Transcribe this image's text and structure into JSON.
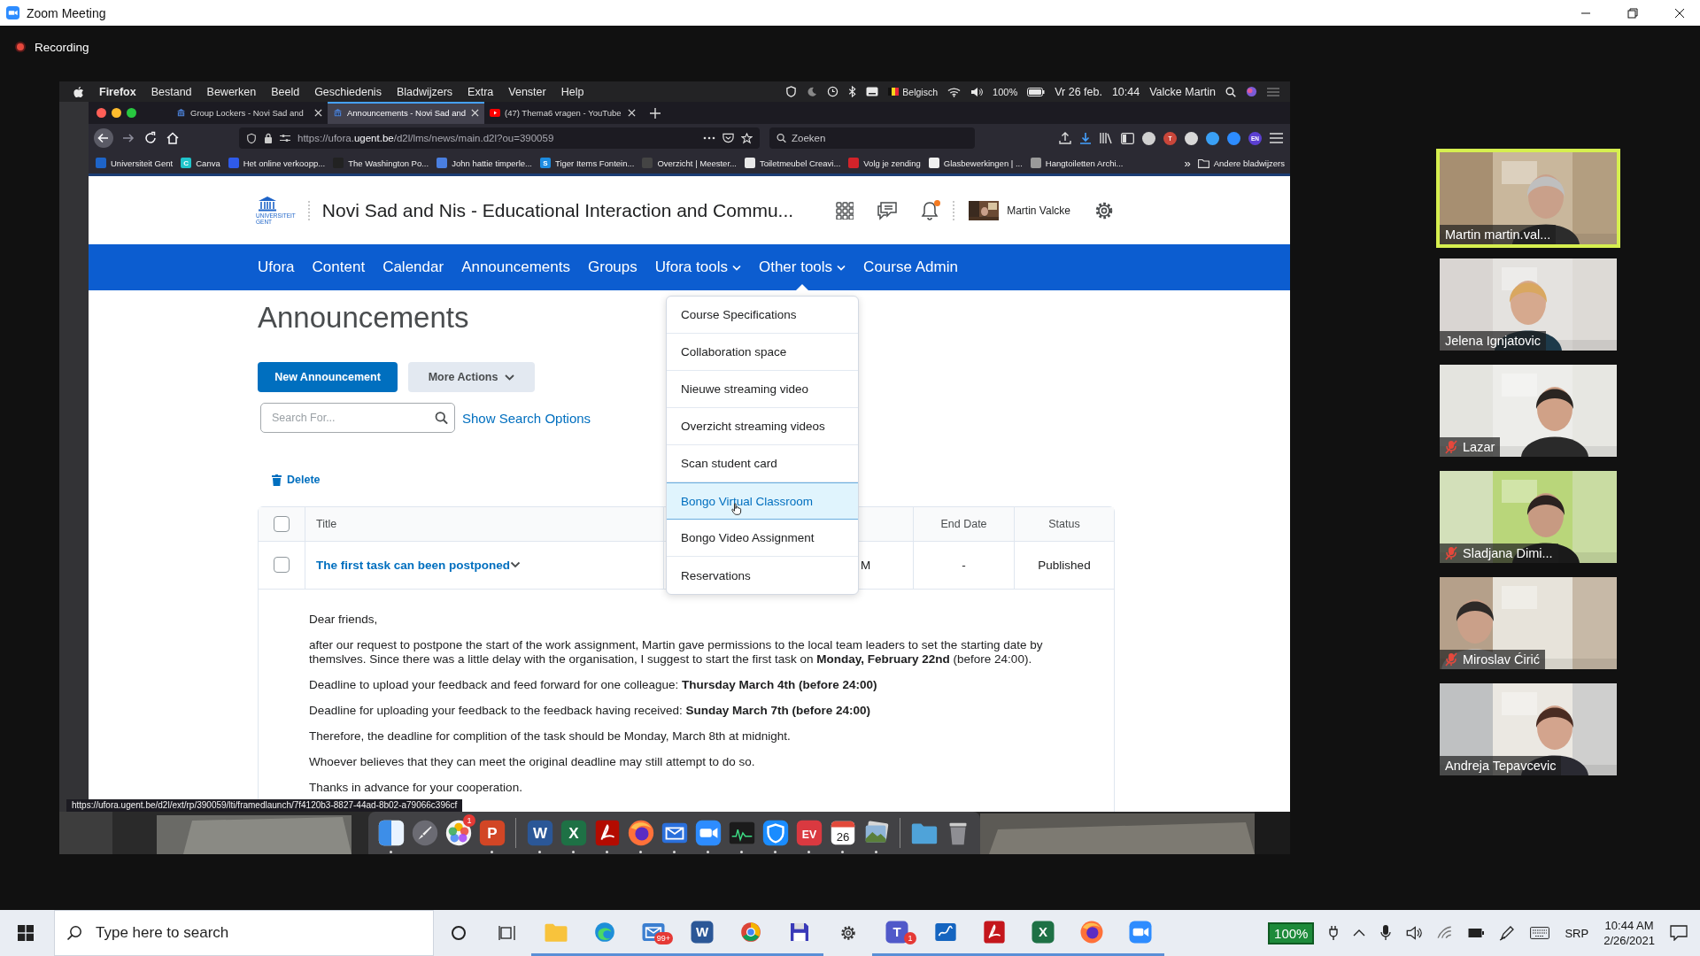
{
  "zoom_window": {
    "title": "Zoom Meeting"
  },
  "recording": {
    "label": "Recording"
  },
  "mac_menu_bar": {
    "app": "Firefox",
    "menus": [
      "Bestand",
      "Bewerken",
      "Beeld",
      "Geschiedenis",
      "Bladwijzers",
      "Extra",
      "Venster",
      "Help"
    ],
    "keyboard_layout": "Belgisch",
    "battery": "100%",
    "date": "Vr 26 feb.",
    "time": "10:44",
    "user": "Valcke Martin"
  },
  "browser": {
    "tabs": [
      {
        "title": "Group Lockers - Novi Sad and",
        "selected": false
      },
      {
        "title": "Announcements - Novi Sad and",
        "selected": true
      },
      {
        "title": "(47) Thema6 vragen - YouTube",
        "selected": false
      }
    ],
    "url": {
      "prefix": "https://ufora.",
      "host": "ugent.be",
      "path": "/d2l/lms/news/main.d2l?ou=390059"
    },
    "search": {
      "placeholder": "Zoeken"
    },
    "extensions": [
      {
        "color": "#d0d0d0"
      },
      {
        "color": "#c9463a",
        "label": "T"
      },
      {
        "color": "#d8d8d8"
      },
      {
        "color": "#3aa0f5"
      },
      {
        "color": "#2d8cff"
      },
      {
        "color": "#5b3fd1",
        "label": "EN"
      }
    ],
    "bookmarks": [
      {
        "label": "Universiteit Gent",
        "color": "#1e64c8"
      },
      {
        "label": "Canva",
        "color": "#20c4cb",
        "glyph": "C"
      },
      {
        "label": "Het online verkoopp...",
        "color": "#2f5bea"
      },
      {
        "label": "The Washington Po...",
        "color": "#222222"
      },
      {
        "label": "John hattie timperle...",
        "color": "#4a7fe0"
      },
      {
        "label": "Tiger Items Fontein...",
        "color": "#1d8ce0",
        "glyph": "S"
      },
      {
        "label": "Overzicht | Meester...",
        "color": "#444444"
      },
      {
        "label": "Toiletmeubel Creavi...",
        "color": "#e8e8e8"
      },
      {
        "label": "Volg je zending",
        "color": "#d2232a"
      },
      {
        "label": "Glasbewerkingen | ...",
        "color": "#f0f0f0"
      },
      {
        "label": "Hangtoiletten Archi...",
        "color": "#9a9a9a"
      }
    ],
    "bookmarks_more": "»",
    "other_bookmarks": "Andere bladwijzers",
    "status_url": "https://ufora.ugent.be/d2l/ext/rp/390059/lti/framedlaunch/7f4120b3-8827-44ad-8b02-a79066c396cf"
  },
  "page": {
    "logo": {
      "line1": "UNIVERSITEIT",
      "line2": "GENT"
    },
    "course_title": "Novi Sad and Nis - Educational Interaction and Commu...",
    "unread": true,
    "user": "Martin Valcke",
    "nav": [
      {
        "label": "Ufora",
        "dropdown": false,
        "expanded": false
      },
      {
        "label": "Content",
        "dropdown": false,
        "expanded": false
      },
      {
        "label": "Calendar",
        "dropdown": false,
        "expanded": false
      },
      {
        "label": "Announcements",
        "dropdown": false,
        "expanded": false
      },
      {
        "label": "Groups",
        "dropdown": false,
        "expanded": false
      },
      {
        "label": "Ufora tools",
        "dropdown": true,
        "expanded": false
      },
      {
        "label": "Other tools",
        "dropdown": true,
        "expanded": true
      },
      {
        "label": "Course Admin",
        "dropdown": false,
        "expanded": false
      }
    ],
    "menu": [
      {
        "label": "Course Specifications",
        "selected": false
      },
      {
        "label": "Collaboration space",
        "selected": false
      },
      {
        "label": "Nieuwe streaming video",
        "selected": false
      },
      {
        "label": "Overzicht streaming videos",
        "selected": false
      },
      {
        "label": "Scan student card",
        "selected": false
      },
      {
        "label": "Bongo Virtual Classroom",
        "selected": true
      },
      {
        "label": "Bongo Video Assignment",
        "selected": false
      },
      {
        "label": "Reservations",
        "selected": false
      }
    ],
    "heading": "Announcements",
    "new_button": "New Announcement",
    "more_button": "More Actions",
    "search": {
      "placeholder": "Search For..."
    },
    "search_options": "Show Search Options",
    "delete": "Delete",
    "table": {
      "header_checked": false,
      "columns": {
        "title": "Title",
        "end_date": "End Date",
        "status": "Status"
      },
      "rows": [
        {
          "checked": false,
          "title": "The first task can been postponed",
          "column_3": "M",
          "end_date": "-",
          "status": "Published",
          "expanded": true
        }
      ]
    },
    "body": [
      "Dear friends,",
      "after our request to postpone the start of the work assignment, Martin gave permissions to the local team leaders to set the starting date by themslves. Since there was a little delay with the organisation, I suggest to start the first task on **Monday, February 22nd** (before 24:00).",
      "Deadline to upload your feedback and feed forward for one colleague: **Thursday March 4th (before 24:00)**",
      "Deadline for uploading your feedback to the feedback having received: **Sunday March 7th (before 24:00)**",
      "Therefore, the deadline for complition of the task should be Monday, March 8th at midnight.",
      "Whoever believes that they can meet the original deadline may still attempt to do so.",
      "Thanks in advance for your cooperation."
    ]
  },
  "participants": [
    {
      "name": "Martin martin.val...",
      "muted": false,
      "speaking": true
    },
    {
      "name": "Jelena Ignjatovic",
      "muted": false,
      "speaking": false
    },
    {
      "name": "Lazar",
      "muted": true,
      "speaking": false
    },
    {
      "name": "Sladjana Dimi...",
      "muted": true,
      "speaking": false
    },
    {
      "name": "Miroslav Ćirić",
      "muted": true,
      "speaking": false
    },
    {
      "name": "Andreja Tepavcevic",
      "muted": false,
      "speaking": false
    }
  ],
  "dock": {
    "items": [
      {
        "kind": "split",
        "color": "#3d8ee8",
        "running": true
      },
      {
        "kind": "rocket",
        "color": "#6b6b73",
        "running": false
      },
      {
        "kind": "flower",
        "color": "#f4f4f4",
        "badge": "1",
        "running": false
      },
      {
        "kind": "letter",
        "color": "#d24625",
        "glyph": "P",
        "running": true
      },
      {
        "kind": "separator"
      },
      {
        "kind": "letter",
        "color": "#2b5797",
        "glyph": "W",
        "running": true
      },
      {
        "kind": "letter",
        "color": "#1e7145",
        "glyph": "X",
        "running": true
      },
      {
        "kind": "doc",
        "color": "#b30b00",
        "running": true
      },
      {
        "kind": "globe",
        "color": "#ff7139",
        "running": true
      },
      {
        "kind": "envelope",
        "color": "#2a6fdb",
        "running": true
      },
      {
        "kind": "camera",
        "color": "#2d8cff",
        "running": true
      },
      {
        "kind": "monitor",
        "color": "#1b1b1b",
        "running": true
      },
      {
        "kind": "shield",
        "color": "#1a8cff",
        "running": true
      },
      {
        "kind": "letter",
        "color": "#da3940",
        "glyph": "EV",
        "running": true
      },
      {
        "kind": "calendar",
        "color": "#ffffff",
        "glyph": "26",
        "running": true
      },
      {
        "kind": "photos",
        "color": "#8fb4d8",
        "running": true
      },
      {
        "kind": "separator"
      },
      {
        "kind": "folder",
        "color": "#4fa3d9",
        "running": false
      },
      {
        "kind": "trash",
        "color": "#8e8e93",
        "running": false
      }
    ]
  },
  "taskbar": {
    "search_placeholder": "Type here to search",
    "items": [
      {
        "kind": "folder",
        "color": "#f8c33c",
        "running": true
      },
      {
        "kind": "swirl",
        "color": "#1e8fd8",
        "running": true
      },
      {
        "kind": "envelope",
        "color": "#3c7fd0",
        "badge": "99+",
        "running": true
      },
      {
        "kind": "letter",
        "color": "#2b5797",
        "glyph": "W",
        "running": true
      },
      {
        "kind": "ring",
        "color": "#db4437",
        "running": true
      },
      {
        "kind": "floppy",
        "color": "#3a3ab8",
        "running": true
      },
      {
        "kind": "gear",
        "color": "#333333",
        "running": false
      },
      {
        "kind": "letter",
        "color": "#5059c9",
        "glyph": "T",
        "badge": "1",
        "running": true
      },
      {
        "kind": "board",
        "color": "#1565c0",
        "running": true
      },
      {
        "kind": "doc",
        "color": "#c4161c",
        "running": true
      },
      {
        "kind": "letter",
        "color": "#1e7145",
        "glyph": "X",
        "running": true
      },
      {
        "kind": "globe",
        "color": "#ff7139",
        "running": true
      },
      {
        "kind": "camera",
        "color": "#2d8cff",
        "running": true
      }
    ],
    "battery": "100%",
    "language": "SRP",
    "time": "10:44 AM",
    "date": "2/26/2021"
  }
}
